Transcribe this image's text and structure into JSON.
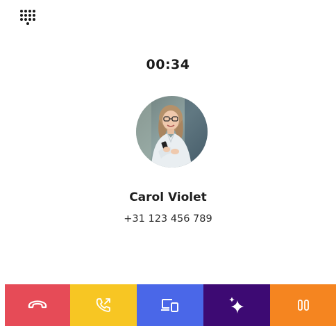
{
  "call": {
    "timer": "00:34",
    "contact_name": "Carol Violet",
    "contact_number": "+31 123 456 789"
  },
  "icons": {
    "dialpad": "dialpad-icon",
    "avatar": "contact-photo",
    "hangup": "phone-hangup-icon",
    "transfer": "call-transfer-icon",
    "switch_device": "switch-device-icon",
    "ai": "sparkles-icon",
    "hold": "pause-icon"
  },
  "actions": [
    {
      "name": "hang-up",
      "color": "#e64b57"
    },
    {
      "name": "transfer",
      "color": "#f7c623"
    },
    {
      "name": "switch-device",
      "color": "#4a67e8"
    },
    {
      "name": "ai-assist",
      "color": "#3d0a73"
    },
    {
      "name": "hold",
      "color": "#f58520"
    }
  ]
}
